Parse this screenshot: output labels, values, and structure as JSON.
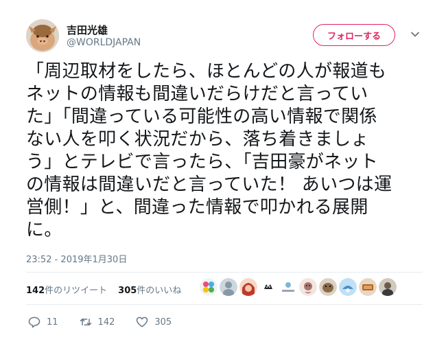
{
  "user": {
    "display_name": "吉田光雄",
    "handle": "@WORLDJAPAN"
  },
  "follow_button": {
    "label": "フォローする",
    "color": "#e0245e"
  },
  "tweet": {
    "text": "「周辺取材をしたら、ほとんどの人が報道も\nネットの情報も間違いだらけだと言ってい\nた」「間違っている可能性の高い情報で関係\nない人を叩く状況だから、落ち着きましょ\nう」とテレビで言ったら、「吉田豪がネット\nの情報は間違いだと言っていた！ あいつは運\n営側！」と、間違った情報で叩かれる展開\nに。",
    "timestamp": "23:52 - 2019年1月30日"
  },
  "stats": {
    "retweets_count": "142",
    "retweets_label": "件のリツイート",
    "likes_count": "305",
    "likes_label": "件のいいね"
  },
  "liker_faces": [
    "face-icon-1",
    "face-icon-2",
    "face-icon-3",
    "face-icon-4",
    "face-icon-5",
    "face-icon-6",
    "face-icon-7",
    "face-icon-8",
    "face-icon-9",
    "face-icon-10"
  ],
  "actions": {
    "reply_count": "11",
    "retweet_count": "142",
    "like_count": "305"
  },
  "icons": {
    "avatar": "pig-mask-avatar",
    "chevron": "chevron-down-icon",
    "reply": "reply-icon",
    "retweet": "retweet-icon",
    "like": "heart-icon"
  }
}
